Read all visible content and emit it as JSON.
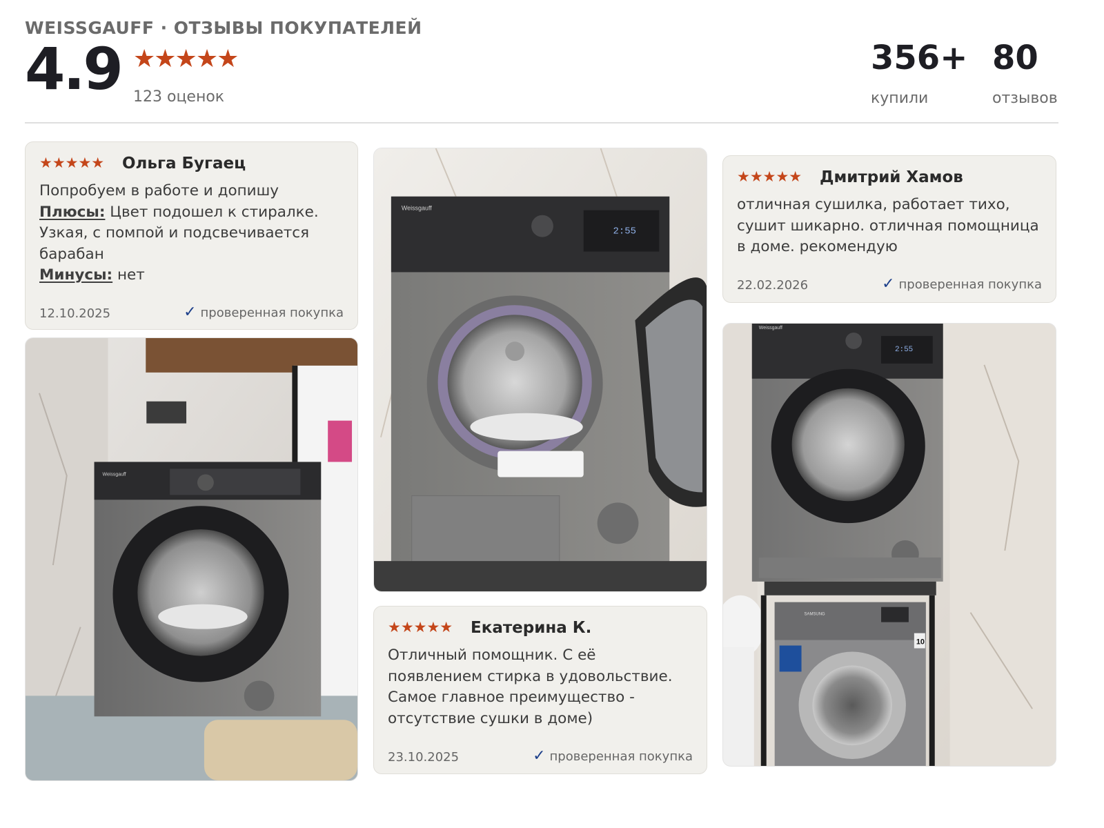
{
  "header": {
    "brand_label": "WEISSGAUFF · ОТЗЫВЫ ПОКУПАТЕЛЕЙ",
    "score": "4.9",
    "stars": "★★★★★",
    "ratings_count": "123 оценок",
    "bought_value": "356+",
    "bought_label": "купили",
    "reviews_value": "80",
    "reviews_label": "отзывов",
    "accent_color": "#c4461a"
  },
  "reviews": [
    {
      "stars": "★★★★★",
      "name": "Ольга Бугаец",
      "line1": "Попробуем в работе и допишу",
      "pros_label": "Плюсы:",
      "pros_text": " Цвет подошел к стиралке.",
      "line3": "Узкая, с помпой и подсвечивается",
      "line4": "барабан",
      "cons_label": "Минусы:",
      "cons_text": " нет",
      "date": "12.10.2025",
      "verified": "проверенная покупка"
    },
    {
      "stars": "★★★★★",
      "name": "Дмитрий Хамов",
      "line1": "отличная сушилка, работает тихо,",
      "line2": "сушит шикарно. отличная помощница",
      "line3": "в доме. рекомендую",
      "date": "22.02.2026",
      "verified": "проверенная покупка"
    },
    {
      "stars": "★★★★★",
      "name": "Екатерина К.",
      "line1": "Отличный помощник. С её",
      "line2": "появлением стирка в удовольствие.",
      "line3": "Самое главное преимущество -",
      "line4": "отсутствие сушки в доме)",
      "date": "23.10.2025",
      "verified": "проверенная покупка"
    }
  ],
  "photos": {
    "brand": "Weissgauff",
    "display": "2:55",
    "samsung": "SAMSUNG",
    "capacity": "10"
  },
  "icons": {
    "check": "✓",
    "verified_color": "#1c3f8a"
  }
}
